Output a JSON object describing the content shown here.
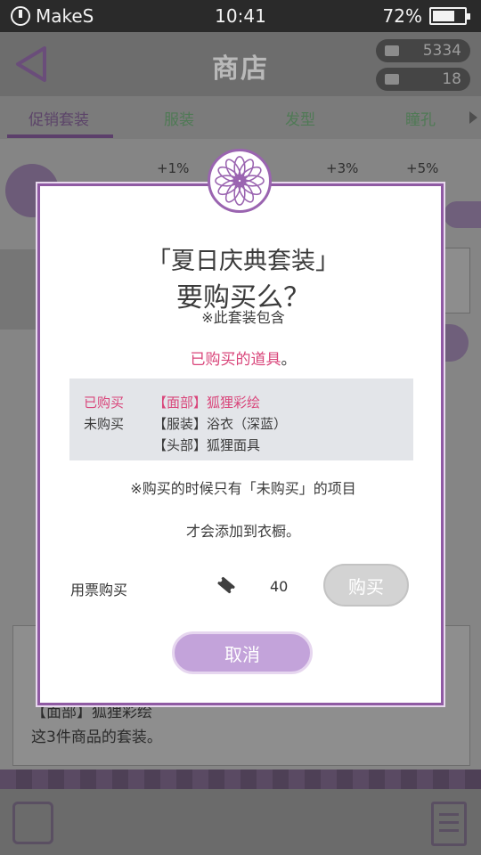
{
  "status_bar": {
    "carrier": "MakeS",
    "time": "10:41",
    "battery_text": "72%",
    "battery_level": 0.72
  },
  "header": {
    "title": "商店",
    "currency_1": "5334",
    "currency_2": "18"
  },
  "tabs": [
    {
      "label": "促销套装",
      "active": true
    },
    {
      "label": "服装",
      "active": false
    },
    {
      "label": "发型",
      "active": false
    },
    {
      "label": "瞳孔",
      "active": false
    }
  ],
  "background": {
    "stats": [
      "+1%",
      "+3%",
      "+5%"
    ],
    "desc_line": "【面部】狐狸彩绘",
    "desc_line2": "这3件商品的套装。"
  },
  "modal": {
    "title_line1": "「夏日庆典套装」",
    "title_line2": "要购买么？",
    "subtitle": "※此套装包含",
    "purchased_phrase": "已购买的道具",
    "purchased_suffix": "。",
    "items": [
      {
        "status": "已购买",
        "item": "【面部】狐狸彩绘",
        "purchased": true
      },
      {
        "status": "未购买",
        "item": "【服装】浴衣（深蓝）",
        "purchased": false
      },
      {
        "status": "",
        "item": "【头部】狐狸面具",
        "purchased": false
      }
    ],
    "note_line1": "※购买的时候只有「未购买」的项目",
    "note_line2": "才会添加到衣橱。",
    "ticket_label": "用票购买",
    "ticket_price": "40",
    "buy_label": "购买",
    "cancel_label": "取消"
  },
  "colors": {
    "accent_purple": "#8f5aa3",
    "pink": "#d9457a",
    "cancel_bg": "#c3a3da",
    "buy_disabled": "#d3d3d3"
  }
}
